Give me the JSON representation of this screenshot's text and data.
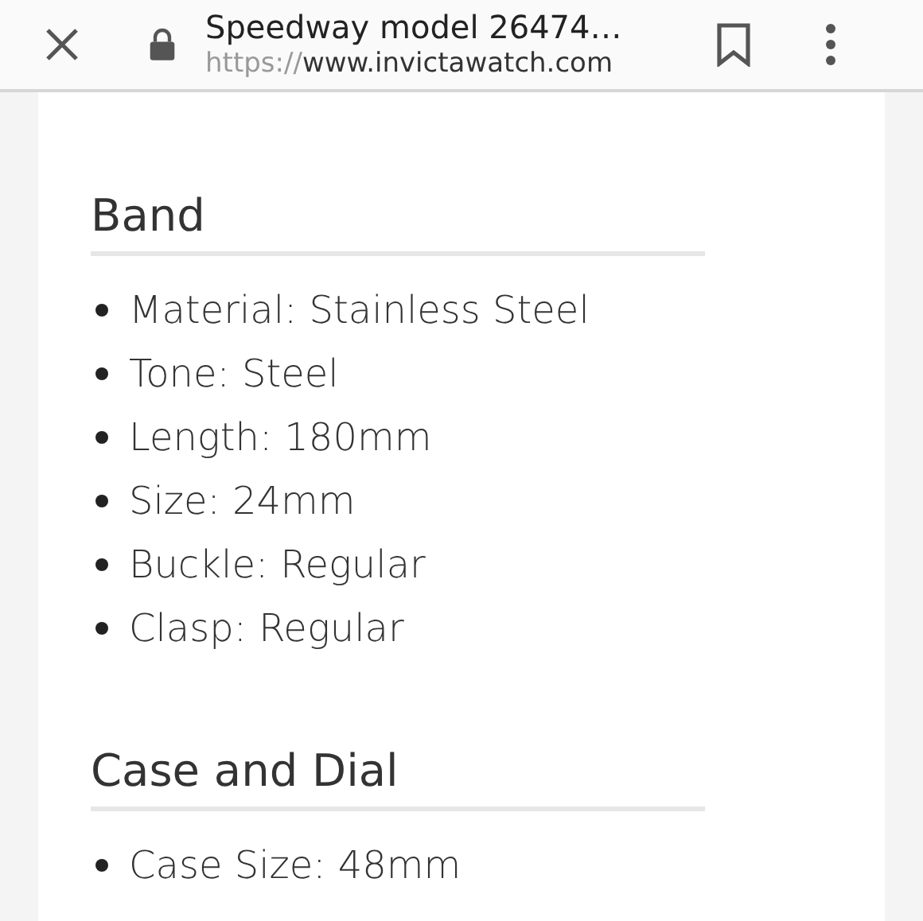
{
  "browser_bar": {
    "title": "Speedway model 26474…",
    "url_scheme": "https://",
    "url_host": "www.invictawatch.com"
  },
  "sections": [
    {
      "heading": "Band",
      "items": [
        "Material: Stainless Steel",
        "Tone: Steel",
        "Length: 180mm",
        "Size: 24mm",
        "Buckle: Regular",
        "Clasp: Regular"
      ]
    },
    {
      "heading": "Case and Dial",
      "items": [
        "Case Size: 48mm"
      ]
    }
  ]
}
